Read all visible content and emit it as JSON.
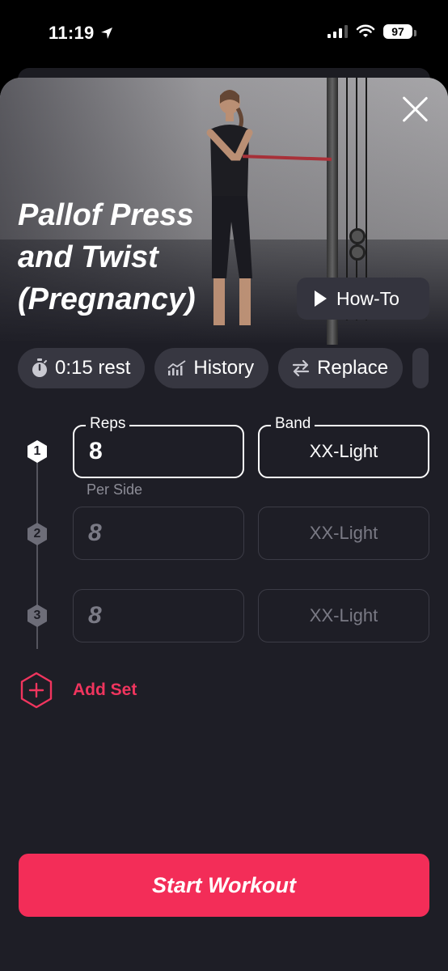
{
  "status_bar": {
    "time": "11:19",
    "battery": "97",
    "icons": [
      "location-arrow-icon",
      "cellular-signal-icon",
      "wifi-icon",
      "battery-icon"
    ]
  },
  "exercise": {
    "title_lines": [
      "Pallof Press",
      "and Twist",
      "(Pregnancy)"
    ],
    "howto_label": "How-To"
  },
  "chips": [
    {
      "label": "0:15 rest",
      "icon": "stopwatch-icon"
    },
    {
      "label": "History",
      "icon": "history-chart-icon"
    },
    {
      "label": "Replace",
      "icon": "swap-arrows-icon"
    }
  ],
  "sets": {
    "reps_label": "Reps",
    "band_label": "Band",
    "per_side_label": "Per Side",
    "rows": [
      {
        "number": "1",
        "reps": "8",
        "band": "XX-Light",
        "active": true
      },
      {
        "number": "2",
        "reps": "8",
        "band": "XX-Light",
        "active": false
      },
      {
        "number": "3",
        "reps": "8",
        "band": "XX-Light",
        "active": false
      }
    ]
  },
  "add_set_label": "Add Set",
  "start_button_label": "Start Workout",
  "colors": {
    "accent": "#f32d58",
    "accent_text": "#f0355e",
    "sheet_bg": "#1e1e26",
    "chip_bg": "#373741",
    "dim_text": "#7a7a85"
  }
}
